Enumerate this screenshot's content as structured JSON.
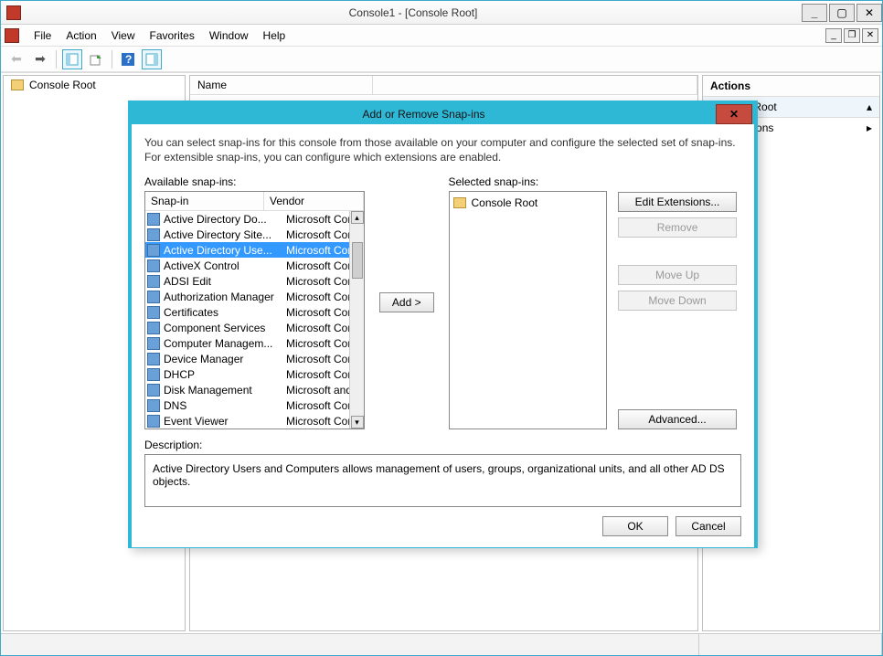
{
  "window": {
    "title": "Console1 - [Console Root]"
  },
  "menus": [
    "File",
    "Action",
    "View",
    "Favorites",
    "Window",
    "Help"
  ],
  "tree": {
    "root": "Console Root"
  },
  "list_headers": {
    "name": "Name"
  },
  "actions": {
    "header": "Actions",
    "section": "Console Root",
    "more": "More Actions"
  },
  "dialog": {
    "title": "Add or Remove Snap-ins",
    "intro": "You can select snap-ins for this console from those available on your computer and configure the selected set of snap-ins. For extensible snap-ins, you can configure which extensions are enabled.",
    "available_label": "Available snap-ins:",
    "selected_label": "Selected snap-ins:",
    "col_snapin": "Snap-in",
    "col_vendor": "Vendor",
    "add": "Add >",
    "edit_ext": "Edit Extensions...",
    "remove": "Remove",
    "move_up": "Move Up",
    "move_down": "Move Down",
    "advanced": "Advanced...",
    "desc_label": "Description:",
    "desc_text": "Active Directory Users and Computers allows management of users, groups, organizational units, and all other AD DS objects.",
    "ok": "OK",
    "cancel": "Cancel",
    "selected_root": "Console Root",
    "snapins": [
      {
        "name": "Active Directory Do...",
        "vendor": "Microsoft Cor...",
        "sel": false
      },
      {
        "name": "Active Directory Site...",
        "vendor": "Microsoft Cor...",
        "sel": false
      },
      {
        "name": "Active Directory Use...",
        "vendor": "Microsoft Cor...",
        "sel": true
      },
      {
        "name": "ActiveX Control",
        "vendor": "Microsoft Cor...",
        "sel": false
      },
      {
        "name": "ADSI Edit",
        "vendor": "Microsoft Cor...",
        "sel": false
      },
      {
        "name": "Authorization Manager",
        "vendor": "Microsoft Cor...",
        "sel": false
      },
      {
        "name": "Certificates",
        "vendor": "Microsoft Cor...",
        "sel": false
      },
      {
        "name": "Component Services",
        "vendor": "Microsoft Cor...",
        "sel": false
      },
      {
        "name": "Computer Managem...",
        "vendor": "Microsoft Cor...",
        "sel": false
      },
      {
        "name": "Device Manager",
        "vendor": "Microsoft Cor...",
        "sel": false
      },
      {
        "name": "DHCP",
        "vendor": "Microsoft Cor...",
        "sel": false
      },
      {
        "name": "Disk Management",
        "vendor": "Microsoft and...",
        "sel": false
      },
      {
        "name": "DNS",
        "vendor": "Microsoft Cor...",
        "sel": false
      },
      {
        "name": "Event Viewer",
        "vendor": "Microsoft Cor...",
        "sel": false
      }
    ]
  }
}
